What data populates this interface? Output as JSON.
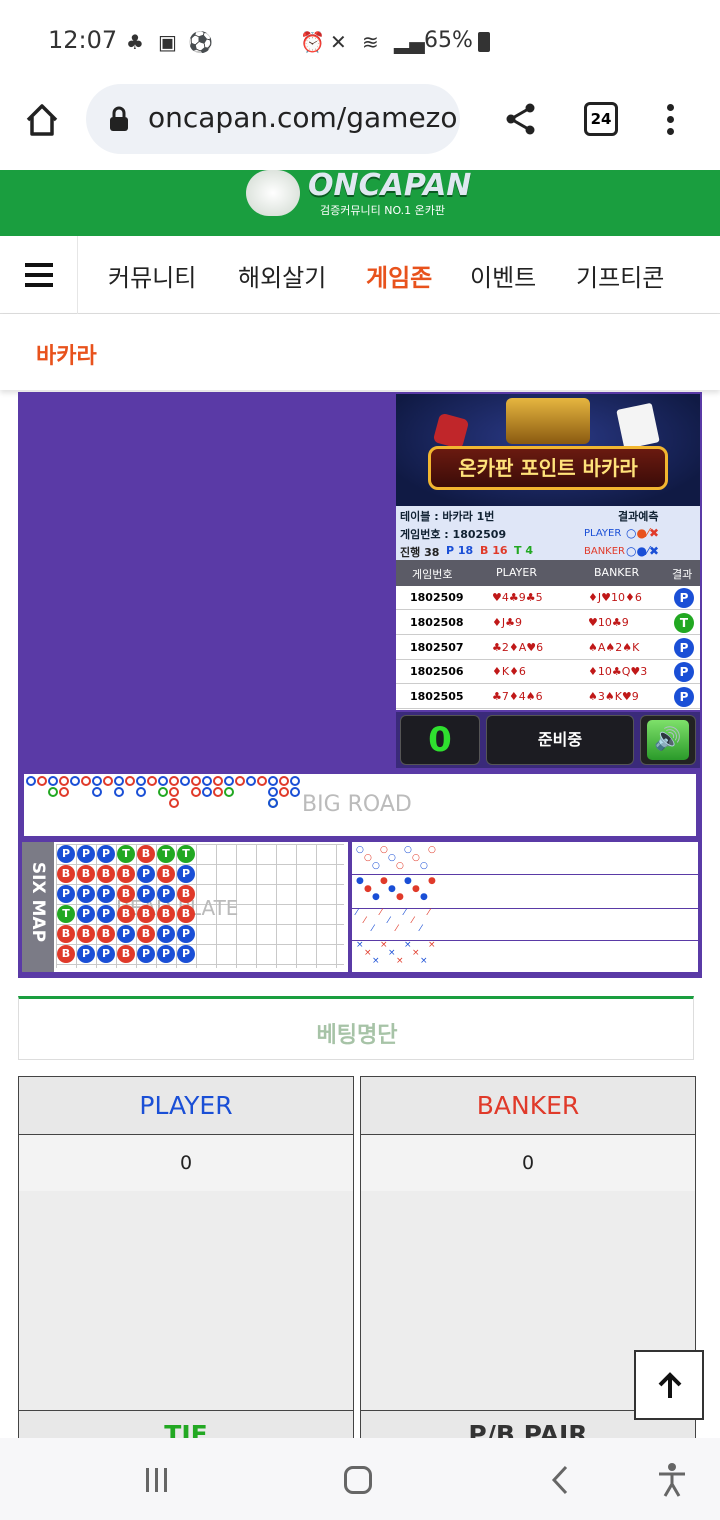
{
  "status": {
    "time": "12:07",
    "battery": "65%"
  },
  "browser": {
    "url": "oncapan.com/gamezo",
    "tab_count": "24"
  },
  "site": {
    "logo_text": "ONCAPAN",
    "logo_sub": "검증커뮤니티 NO.1 온카판",
    "accent": "#1a9e3f"
  },
  "nav": {
    "items": [
      "커뮤니티",
      "해외살기",
      "게임존",
      "이벤트",
      "기프티콘"
    ],
    "active": "게임존",
    "active_color": "#e8521c"
  },
  "subnav": {
    "title": "바카라"
  },
  "game": {
    "banner_title": "온카판 포인트 바카라",
    "table_label": "테이블 : 바카라 1번",
    "round_label": "게임번호 : 1802509",
    "progress": {
      "label": "진행 38",
      "p": "P 18",
      "b": "B 16",
      "t": "T 4"
    },
    "predict_label": "결과예측",
    "predict_player": "PLAYER",
    "predict_banker": "BANKER",
    "history_headers": [
      "게임번호",
      "PLAYER",
      "BANKER",
      "결과"
    ],
    "history": [
      {
        "round": "1802509",
        "player": "♥4♣9♣5",
        "banker": "♦J♥10♦6",
        "result": "P"
      },
      {
        "round": "1802508",
        "player": "♦J♣9",
        "banker": "♥10♣9",
        "result": "T"
      },
      {
        "round": "1802507",
        "player": "♣2♦A♥6",
        "banker": "♠A♠2♠K",
        "result": "P"
      },
      {
        "round": "1802506",
        "player": "♦K♦6",
        "banker": "♦10♣Q♥3",
        "result": "P"
      },
      {
        "round": "1802505",
        "player": "♣7♦4♠6",
        "banker": "♠3♠K♥9",
        "result": "P"
      }
    ],
    "counter": "0",
    "status": "준비중",
    "big_road_label": "BIG ROAD",
    "bead_plate_label": "BEAD PLATE",
    "six_map_label": "SIX MAP",
    "beads": [
      [
        "P",
        "B",
        "P",
        "T",
        "B",
        "B"
      ],
      [
        "P",
        "B",
        "P",
        "P",
        "B",
        "P"
      ],
      [
        "P",
        "B",
        "P",
        "P",
        "B",
        "P"
      ],
      [
        "T",
        "B",
        "B",
        "B",
        "P",
        "B"
      ],
      [
        "B",
        "P",
        "P",
        "B",
        "B",
        "P"
      ],
      [
        "T",
        "B",
        "P",
        "B",
        "P",
        "P"
      ],
      [
        "T",
        "P",
        "B",
        "B",
        "P",
        "P"
      ]
    ]
  },
  "betting": {
    "title": "베팅명단",
    "player_label": "PLAYER",
    "banker_label": "BANKER",
    "player_value": "0",
    "banker_value": "0",
    "tie_label": "TIE",
    "pair_label": "P/B PAIR"
  },
  "colors": {
    "player": "#1a4fd6",
    "banker": "#e03a2a",
    "tie": "#22a822"
  }
}
